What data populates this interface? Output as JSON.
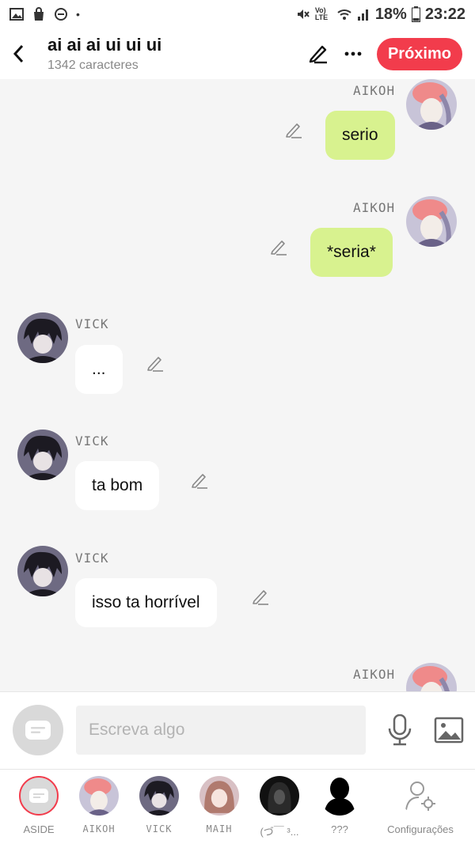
{
  "status_bar": {
    "battery": "18%",
    "time": "23:22",
    "network": "Vo) LTE"
  },
  "header": {
    "title": "ai ai ai ui ui ui",
    "subtitle": "1342 caracteres",
    "next_label": "Próximo",
    "accent_color": "#f23c4c"
  },
  "messages": [
    {
      "author": "AIKOH",
      "text": "serio",
      "side": "right"
    },
    {
      "author": "AIKOH",
      "text": "*seria*",
      "side": "right"
    },
    {
      "author": "VICK",
      "text": "...",
      "side": "left"
    },
    {
      "author": "VICK",
      "text": "ta bom",
      "side": "left"
    },
    {
      "author": "VICK",
      "text": "isso ta horrível",
      "side": "left"
    },
    {
      "author": "AIKOH",
      "text": "",
      "side": "right"
    }
  ],
  "input": {
    "placeholder": "Escreva algo"
  },
  "bottom_nav": [
    {
      "label": "ASIDE"
    },
    {
      "label": "AIKOH"
    },
    {
      "label": "VICK"
    },
    {
      "label": "MAIH"
    },
    {
      "label": "(づ￣ ³..."
    },
    {
      "label": "???"
    },
    {
      "label": "Configurações"
    }
  ]
}
